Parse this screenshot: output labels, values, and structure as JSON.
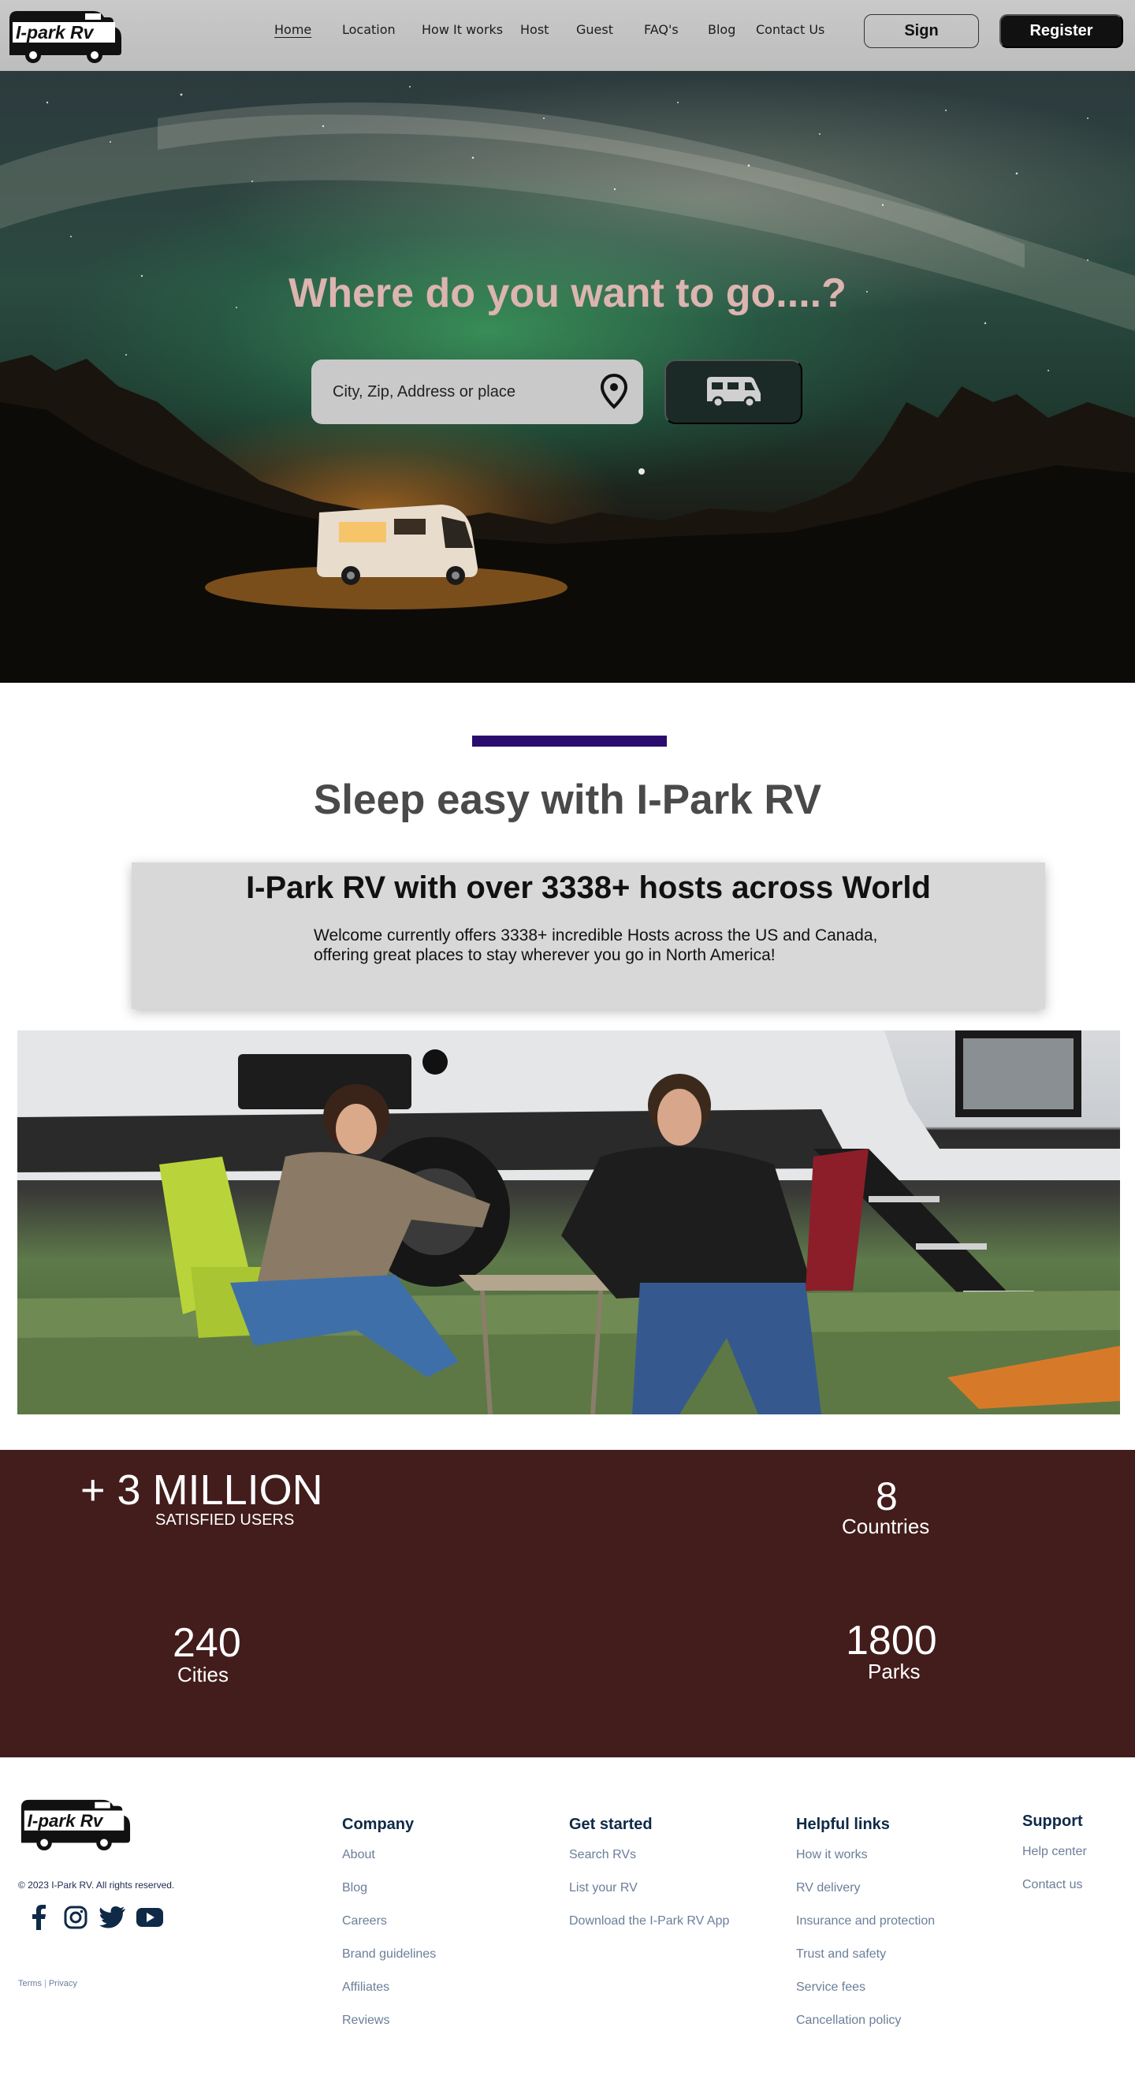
{
  "brand": {
    "logo_text": "I-park Rv"
  },
  "nav": {
    "links": [
      "Home",
      "Location",
      "How It works",
      "Host",
      "Guest",
      "FAQ's",
      "Blog",
      "Contact Us"
    ],
    "sign_label": "Sign",
    "register_label": "Register"
  },
  "hero": {
    "title": "Where do you want to go....?",
    "search_placeholder": "City, Zip, Address or place"
  },
  "intro": {
    "title": "Sleep easy with I-Park RV",
    "card_title": "I-Park RV with over 3338+ hosts across World",
    "card_text": "Welcome currently offers 3338+ incredible Hosts across the US and Canada, offering great places to stay wherever you go in North America!"
  },
  "stats": {
    "users_value": "+ 3 MILLION",
    "users_label": "SATISFIED USERS",
    "countries_value": "8",
    "countries_label": "Countries",
    "cities_value": "240",
    "cities_label": "Cities",
    "parks_value": "1800",
    "parks_label": "Parks"
  },
  "footer": {
    "copyright": "© 2023 I-Park RV. All rights reserved.",
    "terms": "Terms",
    "privacy": "Privacy",
    "company": {
      "heading": "Company",
      "links": [
        "About",
        "Blog",
        "Careers",
        "Brand guidelines",
        "Affiliates",
        "Reviews"
      ]
    },
    "get_started": {
      "heading": "Get started",
      "links": [
        "Search RVs",
        "List your RV",
        "Download the I-Park RV App"
      ]
    },
    "helpful": {
      "heading": "Helpful links",
      "links": [
        "How it works",
        "RV delivery",
        "Insurance and protection",
        "Trust and safety",
        "Service fees",
        "Cancellation policy"
      ]
    },
    "support": {
      "heading": "Support",
      "links": [
        "Help center",
        "Contact us"
      ]
    },
    "social_icons": [
      "facebook-icon",
      "instagram-icon",
      "twitter-icon",
      "youtube-icon"
    ]
  },
  "colors": {
    "nav_bg": "#c4c4c4",
    "hero_title": "#dcb4b0",
    "accent_bar": "#2a0b6e",
    "stats_bg": "#431c1c",
    "footer_heading": "#0e2a47",
    "footer_link": "#6b7e99"
  }
}
